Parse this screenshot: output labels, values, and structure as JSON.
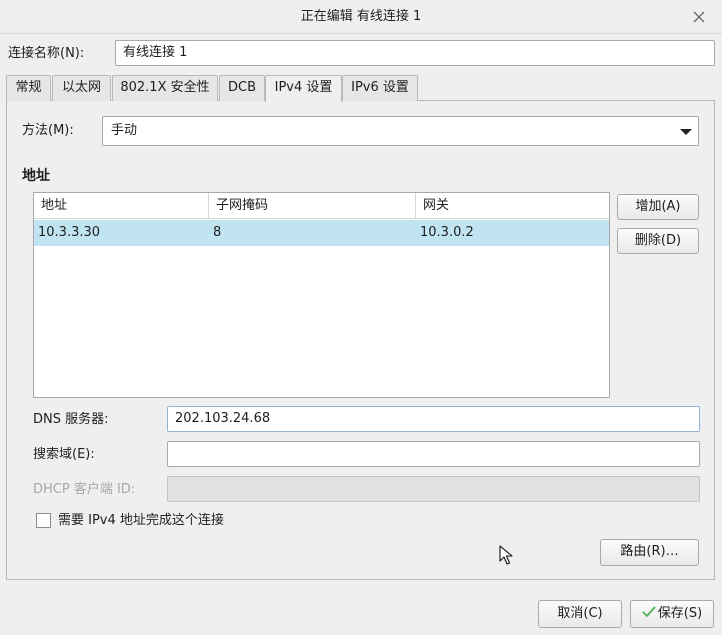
{
  "window": {
    "title": "正在编辑 有线连接 1"
  },
  "connection_name": {
    "label": "连接名称(N):",
    "value": "有线连接 1"
  },
  "tabs": [
    {
      "label": "常规",
      "active": false
    },
    {
      "label": "以太网",
      "active": false
    },
    {
      "label": "802.1X 安全性",
      "active": false
    },
    {
      "label": "DCB",
      "active": false
    },
    {
      "label": "IPv4 设置",
      "active": true
    },
    {
      "label": "IPv6 设置",
      "active": false
    }
  ],
  "method": {
    "label": "方法(M):",
    "value": "手动"
  },
  "addresses": {
    "section_title": "地址",
    "columns": [
      "地址",
      "子网掩码",
      "网关"
    ],
    "rows": [
      {
        "address": "10.3.3.30",
        "netmask": "8",
        "gateway": "10.3.0.2",
        "selected": true
      }
    ],
    "add_button": "增加(A)",
    "delete_button": "删除(D)"
  },
  "dns": {
    "label": "DNS 服务器:",
    "value": "202.103.24.68"
  },
  "search_domains": {
    "label": "搜索域(E):",
    "value": ""
  },
  "dhcp_client_id": {
    "label": "DHCP 客户端 ID:",
    "value": "",
    "enabled": false
  },
  "require_ipv4": {
    "label": "需要 IPv4 地址完成这个连接",
    "checked": false
  },
  "routes_button": "路由(R)…",
  "footer": {
    "cancel_button": "取消(C)",
    "save_button": "保存(S)"
  },
  "colors": {
    "selected_row": "#c1e4f2",
    "save_check": "#4caf50"
  }
}
